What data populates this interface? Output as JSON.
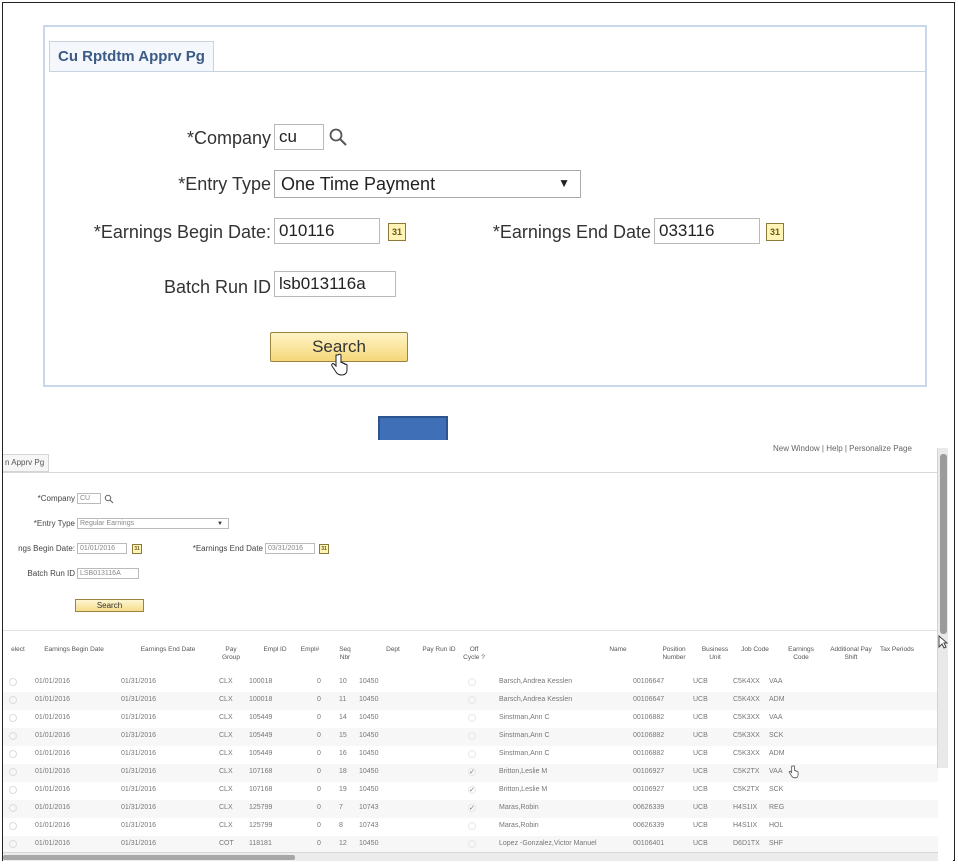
{
  "top": {
    "tab_title": "Cu Rptdtm Apprv Pg",
    "company_label": "*Company",
    "company_value": "cu",
    "entry_type_label": "*Entry Type",
    "entry_type_value": "One Time Payment",
    "begin_date_label": "*Earnings Begin Date:",
    "begin_date_value": "010116",
    "end_date_label": "*Earnings End Date",
    "end_date_value": "033116",
    "batch_label": "Batch Run ID",
    "batch_value": "lsb013116a",
    "search_label": "Search",
    "calendar_glyph": "31"
  },
  "bottom": {
    "links": "New Window | Help | Personalize Page",
    "tab_title": "n Apprv Pg",
    "company_label": "*Company",
    "company_value": "CU",
    "entry_type_label": "*Entry Type",
    "entry_type_value": "Regular Earnings",
    "begin_date_label": "ngs Begin Date:",
    "begin_date_value": "01/01/2016",
    "end_date_label": "*Earnings End Date",
    "end_date_value": "03/31/2016",
    "batch_label": "Batch Run ID",
    "batch_value": "LSB013116A",
    "search_label": "Search",
    "columns": [
      "elect",
      "Earnings Begin Date",
      "Earnings End Date",
      "Pay Group",
      "Empl ID",
      "Empl#",
      "Seq Nbr",
      "Dept",
      "Pay Run ID",
      "Off Cycle ?",
      "Name",
      "Position Number",
      "Business Unit",
      "Job Code",
      "Earnings Code",
      "Additional Pay Shift",
      "Tax Periods"
    ],
    "rows": [
      {
        "begin": "01/01/2016",
        "end": "01/31/2016",
        "group": "CLX",
        "emplid": "100018",
        "rcd": "0",
        "seq": "10",
        "dept": "10450",
        "off": "",
        "name": "Barsch,Andrea Kesslen",
        "pos": "00106647",
        "bu": "UCB",
        "job": "C5K4XX",
        "earn": "VAA"
      },
      {
        "begin": "01/01/2016",
        "end": "01/31/2016",
        "group": "CLX",
        "emplid": "100018",
        "rcd": "0",
        "seq": "11",
        "dept": "10450",
        "off": "",
        "name": "Barsch,Andrea Kesslen",
        "pos": "00106647",
        "bu": "UCB",
        "job": "C5K4XX",
        "earn": "ADM"
      },
      {
        "begin": "01/01/2016",
        "end": "01/31/2016",
        "group": "CLX",
        "emplid": "105449",
        "rcd": "0",
        "seq": "14",
        "dept": "10450",
        "off": "",
        "name": "Sinstman,Ann C",
        "pos": "00106882",
        "bu": "UCB",
        "job": "C5K3XX",
        "earn": "VAA"
      },
      {
        "begin": "01/01/2016",
        "end": "01/31/2016",
        "group": "CLX",
        "emplid": "105449",
        "rcd": "0",
        "seq": "15",
        "dept": "10450",
        "off": "",
        "name": "Sinstman,Ann C",
        "pos": "00106882",
        "bu": "UCB",
        "job": "C5K3XX",
        "earn": "SCK"
      },
      {
        "begin": "01/01/2016",
        "end": "01/31/2016",
        "group": "CLX",
        "emplid": "105449",
        "rcd": "0",
        "seq": "16",
        "dept": "10450",
        "off": "",
        "name": "Sinstman,Ann C",
        "pos": "00106882",
        "bu": "UCB",
        "job": "C5K3XX",
        "earn": "ADM"
      },
      {
        "begin": "01/01/2016",
        "end": "01/31/2016",
        "group": "CLX",
        "emplid": "107168",
        "rcd": "0",
        "seq": "18",
        "dept": "10450",
        "off": "✓",
        "name": "Britton,Leslie M",
        "pos": "00106927",
        "bu": "UCB",
        "job": "C5K2TX",
        "earn": "VAA"
      },
      {
        "begin": "01/01/2016",
        "end": "01/31/2016",
        "group": "CLX",
        "emplid": "107168",
        "rcd": "0",
        "seq": "19",
        "dept": "10450",
        "off": "✓",
        "name": "Britton,Leslie M",
        "pos": "00106927",
        "bu": "UCB",
        "job": "C5K2TX",
        "earn": "SCK"
      },
      {
        "begin": "01/01/2016",
        "end": "01/31/2016",
        "group": "CLX",
        "emplid": "125799",
        "rcd": "0",
        "seq": "7",
        "dept": "10743",
        "off": "✓",
        "name": "Maras,Robin",
        "pos": "00626339",
        "bu": "UCB",
        "job": "H4S1IX",
        "earn": "REG"
      },
      {
        "begin": "01/01/2016",
        "end": "01/31/2016",
        "group": "CLX",
        "emplid": "125799",
        "rcd": "0",
        "seq": "8",
        "dept": "10743",
        "off": "",
        "name": "Maras,Robin",
        "pos": "00626339",
        "bu": "UCB",
        "job": "H4S1IX",
        "earn": "HOL"
      },
      {
        "begin": "01/01/2016",
        "end": "01/31/2016",
        "group": "COT",
        "emplid": "118181",
        "rcd": "0",
        "seq": "12",
        "dept": "10450",
        "off": "",
        "name": "Lopez -Gonzalez,Victor Manuel",
        "pos": "00106401",
        "bu": "UCB",
        "job": "D6D1TX",
        "earn": "SHF"
      }
    ]
  },
  "colors": {
    "panel_border": "#c9d7ea",
    "tab_text": "#3b5a86",
    "arrow_fill": "#3f6fb6",
    "arrow_stroke": "#2c5590",
    "button_top": "#fff4c6",
    "button_bottom": "#f5d77a"
  }
}
